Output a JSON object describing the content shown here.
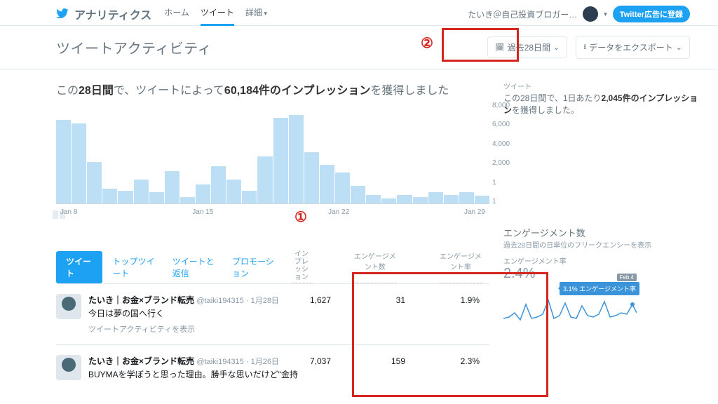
{
  "brand": "アナリティクス",
  "nav": {
    "home": "ホーム",
    "tweets": "ツイート",
    "more": "詳細"
  },
  "user": {
    "name": "たいき＠自己投資ブロガー…"
  },
  "ad_button": "Twitter広告に登録",
  "page_title": "ツイートアクティビティ",
  "date_button": "過去28日間",
  "export_button": "データをエクスポート",
  "summary_pre": "この",
  "summary_days": "28日間",
  "summary_mid": "で、ツイートによって",
  "summary_val": "60,184件のインプレッション",
  "summary_post": "を獲得しました",
  "annotation1": "①",
  "annotation2": "②",
  "tabs": {
    "tweets": "ツイート",
    "top": "トップツイート",
    "replies": "ツイートと返信",
    "promo": "プロモーション"
  },
  "th": {
    "imp": "インプレッション",
    "eng": "エンゲージメント数",
    "rate": "エンゲージメント率"
  },
  "rows": [
    {
      "name": "たいき｜お金×ブランド転売",
      "handle": "@taiki194315",
      "date": "1月28日",
      "text": "今日は夢の国へ行く",
      "link": "ツイートアクティビティを表示",
      "imp": "1,627",
      "eng": "31",
      "rate": "1.9%"
    },
    {
      "name": "たいき｜お金×ブランド転売",
      "handle": "@taiki194315",
      "date": "1月26日",
      "text": "BUYMAを学ぼうと思った理由。勝手な思いだけど\"金持",
      "link": "",
      "imp": "7,037",
      "eng": "159",
      "rate": "2.3%"
    }
  ],
  "side": {
    "tw_label": "ツイート",
    "tw_text_pre": "この28日間で、1日あたり",
    "tw_text_b": "2,045件のインプレッション",
    "tw_text_post": "を獲得しました。",
    "eng_h": "エンゲージメント数",
    "eng_sub": "過去28日間の日単位のフリークエンシーを表示",
    "eng_rate_label": "エンゲージメント率",
    "eng_rate_val": "2.4%",
    "tip_date": "Feb 4",
    "tip_text": "3.1% エンゲージメント率"
  },
  "chart_data": {
    "type": "bar",
    "ylabel": "",
    "xlabel": "",
    "ylim": [
      0,
      8000
    ],
    "yticks": [
      "8,000",
      "6,000",
      "4,000",
      "2,000",
      "1",
      "1"
    ],
    "categories": [
      "Jan 8",
      "Jan 15",
      "Jan 22",
      "Jan 29"
    ],
    "values": [
      6700,
      6400,
      3300,
      1200,
      1000,
      1900,
      900,
      2600,
      500,
      1500,
      3000,
      1900,
      1000,
      3800,
      6900,
      7100,
      4100,
      3100,
      2500,
      1400,
      700,
      400,
      700,
      500,
      900,
      700,
      900,
      600
    ],
    "ymax": 8000
  }
}
